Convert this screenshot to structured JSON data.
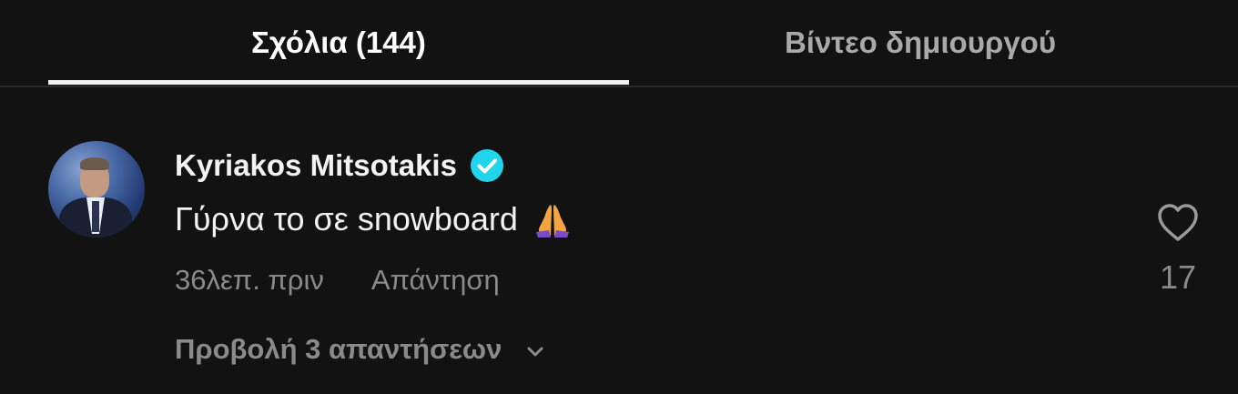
{
  "tabs": {
    "comments_label": "Σχόλια (144)",
    "creator_videos_label": "Βίντεο δημιουργού"
  },
  "comment": {
    "author": "Kyriakos Mitsotakis",
    "verified": true,
    "text": "Γύρνα το σε snowboard",
    "emoji": "folded-hands",
    "time_ago": "36λεπ. πριν",
    "reply_label": "Απάντηση",
    "like_count": "17",
    "view_replies_label": "Προβολή 3 απαντήσεων"
  },
  "colors": {
    "background": "#121212",
    "active_text": "#ffffff",
    "muted_text": "#8a8a8a",
    "verified_badge": "#20d5ec"
  },
  "icons": {
    "verified": "verified-badge-icon",
    "like": "heart-icon",
    "expand": "chevron-down-icon",
    "emoji": "folded-hands-icon"
  }
}
